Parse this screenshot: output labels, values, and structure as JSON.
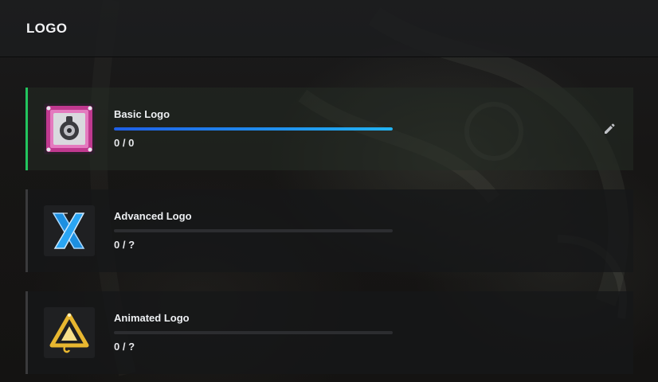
{
  "header": {
    "title": "LOGO"
  },
  "items": [
    {
      "title": "Basic Logo",
      "count": "0 / 0",
      "progress": 1.0,
      "active": true,
      "icon": "pink-lock-logo-icon",
      "editable": true
    },
    {
      "title": "Advanced Logo",
      "count": "0 / ?",
      "progress": 0,
      "active": false,
      "icon": "blue-x-logo-icon",
      "editable": false
    },
    {
      "title": "Animated Logo",
      "count": "0 / ?",
      "progress": 0,
      "active": false,
      "icon": "gold-triangle-logo-icon",
      "editable": false
    }
  ],
  "colors": {
    "active_border": "#22c55e",
    "progress_start": "#1f5fe6",
    "progress_end": "#22b4f2"
  }
}
